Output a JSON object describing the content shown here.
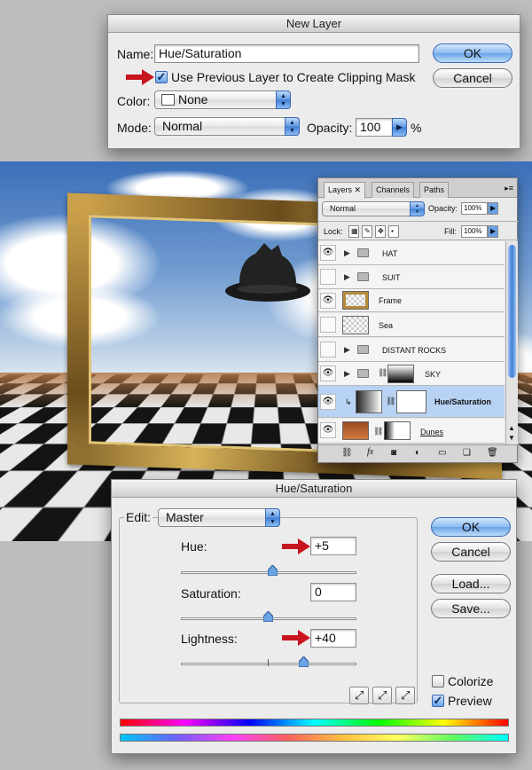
{
  "new_layer": {
    "title": "New Layer",
    "name_label": "Name:",
    "name_value": "Hue/Saturation",
    "clip_label": "Use Previous Layer to Create Clipping Mask",
    "color_label": "Color:",
    "color_value": "None",
    "mode_label": "Mode:",
    "mode_value": "Normal",
    "opacity_label": "Opacity:",
    "opacity_value": "100",
    "opacity_unit": "%",
    "ok": "OK",
    "cancel": "Cancel"
  },
  "layers_panel": {
    "tabs": [
      "Layers",
      "Channels",
      "Paths"
    ],
    "blend_mode": "Normal",
    "opacity_label": "Opacity:",
    "opacity_value": "100%",
    "lock_label": "Lock:",
    "fill_label": "Fill:",
    "fill_value": "100%",
    "layers": [
      "HAT",
      "SUIT",
      "Frame",
      "Sea",
      "DISTANT ROCKS",
      "SKY",
      "Hue/Saturation",
      "Dunes"
    ],
    "footer_icons": [
      "link-icon",
      "fx-icon",
      "mask-icon",
      "adjustment-icon",
      "folder-icon",
      "new-layer-icon",
      "trash-icon"
    ]
  },
  "hue_sat": {
    "title": "Hue/Saturation",
    "edit_label": "Edit:",
    "edit_value": "Master",
    "hue_label": "Hue:",
    "hue_value": "+5",
    "sat_label": "Saturation:",
    "sat_value": "0",
    "light_label": "Lightness:",
    "light_value": "+40",
    "ok": "OK",
    "cancel": "Cancel",
    "load": "Load...",
    "save": "Save...",
    "colorize": "Colorize",
    "preview": "Preview"
  },
  "colors": {
    "accent": "#5d98e2",
    "arrow": "#c8141e",
    "selected_row": "#b8d2f4"
  }
}
